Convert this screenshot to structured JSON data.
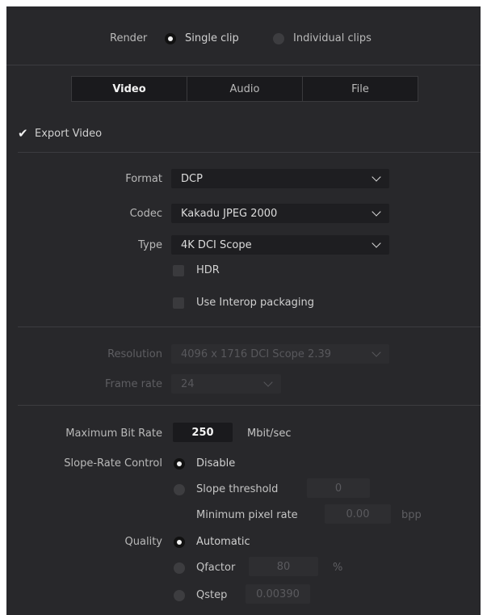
{
  "render": {
    "label": "Render",
    "options": [
      {
        "label": "Single clip",
        "selected": true
      },
      {
        "label": "Individual clips",
        "selected": false
      }
    ]
  },
  "tabs": [
    {
      "label": "Video",
      "selected": true
    },
    {
      "label": "Audio",
      "selected": false
    },
    {
      "label": "File",
      "selected": false
    }
  ],
  "export_video": {
    "label": "Export Video",
    "checked": true
  },
  "format": {
    "label": "Format",
    "value": "DCP"
  },
  "codec": {
    "label": "Codec",
    "value": "Kakadu JPEG 2000"
  },
  "type": {
    "label": "Type",
    "value": "4K DCI Scope"
  },
  "hdr": {
    "label": "HDR",
    "checked": false
  },
  "interop": {
    "label": "Use Interop packaging",
    "checked": false
  },
  "resolution": {
    "label": "Resolution",
    "value": "4096 x 1716 DCI Scope 2.39"
  },
  "frame_rate": {
    "label": "Frame rate",
    "value": "24"
  },
  "max_bit_rate": {
    "label": "Maximum Bit Rate",
    "value": "250",
    "unit": "Mbit/sec"
  },
  "slope_rate": {
    "label": "Slope-Rate Control",
    "disable_label": "Disable",
    "threshold_label": "Slope threshold",
    "threshold_value": "0",
    "min_pixel_label": "Minimum pixel rate",
    "min_pixel_value": "0.00",
    "min_pixel_unit": "bpp"
  },
  "quality": {
    "label": "Quality",
    "automatic_label": "Automatic",
    "qfactor_label": "Qfactor",
    "qfactor_value": "80",
    "qfactor_unit": "%",
    "qstep_label": "Qstep",
    "qstep_value": "0.00390"
  }
}
